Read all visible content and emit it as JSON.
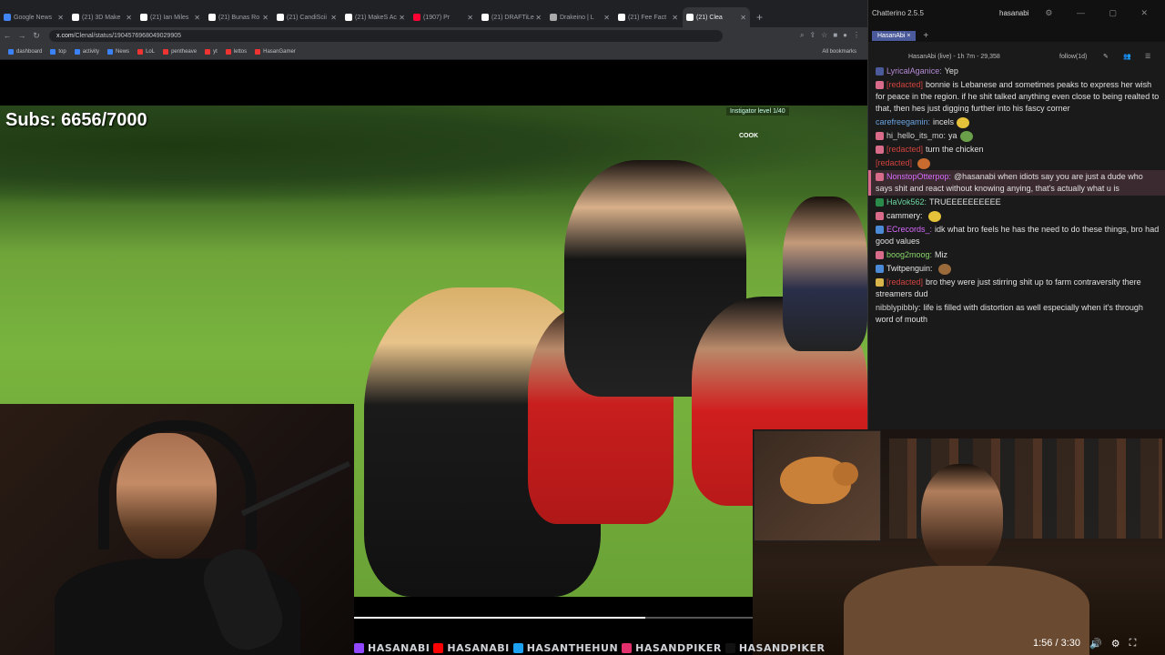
{
  "browser": {
    "tabs": [
      {
        "label": "Google News",
        "color": "#4285f4"
      },
      {
        "label": "(21) 3D Make",
        "color": "#ffffff"
      },
      {
        "label": "(21) Ian Miles",
        "color": "#ffffff"
      },
      {
        "label": "(21) Bunas Ro",
        "color": "#ffffff"
      },
      {
        "label": "(21) CandiScii",
        "color": "#ffffff"
      },
      {
        "label": "(21) MakeS Ac",
        "color": "#ffffff"
      },
      {
        "label": "(1907) Pr",
        "color": "#ff0033"
      },
      {
        "label": "(21) DRAFTiLe",
        "color": "#ffffff"
      },
      {
        "label": "Drakeino | L",
        "color": "#aaaaaa"
      },
      {
        "label": "(21) Fee Fact",
        "color": "#ffffff"
      },
      {
        "label": "(21) Clea",
        "color": "#ffffff"
      }
    ],
    "new_tab": "+",
    "url_host": "x.com",
    "url_path": "/Clenal/status/1904576968049029905",
    "bookmarks": [
      {
        "label": "dashboard",
        "color": "#3b82f6"
      },
      {
        "label": "top",
        "color": "#3b82f6"
      },
      {
        "label": "activity",
        "color": "#3b82f6"
      },
      {
        "label": "News",
        "color": "#3b82f6"
      },
      {
        "label": "LoL",
        "color": "#e33"
      },
      {
        "label": "pentheave",
        "color": "#e33"
      },
      {
        "label": "yt",
        "color": "#e33"
      },
      {
        "label": "lettos",
        "color": "#e33"
      },
      {
        "label": "HasanGamer",
        "color": "#e33"
      }
    ],
    "all_bookmarks": "All bookmarks"
  },
  "video": {
    "subs_overlay": "Subs: 6656/7000",
    "instigator_text": "Instigator level 1/40",
    "cook_text": "COOK",
    "progress_percent": 73,
    "time_display": "1:56 / 3:30"
  },
  "brand_strip": [
    {
      "label": "HASANABI",
      "color": "#9146ff"
    },
    {
      "label": "HASANABI",
      "color": "#ff0000"
    },
    {
      "label": "HASANTHEHUN",
      "color": "#1da1f2"
    },
    {
      "label": "HASANDPIKER",
      "color": "#e1306c"
    },
    {
      "label": "HASANDPIKER",
      "color": "#111111"
    }
  ],
  "chatterino": {
    "title": "Chatterino 2.5.5",
    "user": "hasanabi",
    "tab_label": "HasanAbi",
    "tab_close": "×",
    "tab_add": "+",
    "header": "HasanAbi (live) - 1h 7m - 29,358",
    "follow": "follow(1d)",
    "messages": [
      {
        "user": "LyricalAganice:",
        "text": "Yep",
        "color": "#b58ad6",
        "highlight": false,
        "badge": "#4b5a9a"
      },
      {
        "user": "[redacted]",
        "text": "bonnie is Lebanese and sometimes peaks to express her wish for peace in the region. if he shit talked anything even close to being realted to that, then hes just digging further into his fascy corner",
        "color": "#d0433f",
        "highlight": false,
        "badge": "#d86b8a"
      },
      {
        "user": "carefreegamin:",
        "text": "incels",
        "color": "#69a3e0",
        "highlight": false,
        "badge": "",
        "emote": "#e6c23a"
      },
      {
        "user": "hi_hello_its_mo:",
        "text": "ya",
        "color": "#d0d0d0",
        "highlight": false,
        "badge": "#d86b8a",
        "emote": "#6aa04a"
      },
      {
        "user": "[redacted]",
        "text": "turn the chicken",
        "color": "#d0433f",
        "highlight": false,
        "badge": "#d86b8a"
      },
      {
        "user": "[redacted]",
        "text": "",
        "color": "#d0433f",
        "highlight": false,
        "badge": "",
        "emote": "#c96b2e"
      },
      {
        "user": "NonstopOtterpop:",
        "text": "@hasanabi when idiots say you are just a dude who says shit and react without knowing anying, that's actually what u is",
        "color": "#d86bff",
        "highlight": true,
        "badge": "#d86b8a"
      },
      {
        "user": "HaVok562:",
        "text": "TRUEEEEEEEEEE",
        "color": "#6ad6a0",
        "highlight": false,
        "badge": "#2a8a4a"
      },
      {
        "user": "cammery:",
        "text": "",
        "color": "#e6e6e6",
        "highlight": false,
        "badge": "#d86b8a",
        "emote": "#e6c23a"
      },
      {
        "user": "ECrecords_:",
        "text": "idk what bro feels he has the need to do these things, bro had good values",
        "color": "#d86bff",
        "highlight": false,
        "badge": "#4b8ad6"
      },
      {
        "user": "boog2moog:",
        "text": "Miz",
        "color": "#8ad66b",
        "highlight": false,
        "badge": "#d86b8a"
      },
      {
        "user": "Twitpenguin:",
        "text": "",
        "color": "#e6e6e6",
        "highlight": false,
        "badge": "#4b8ad6",
        "emote": "#9a6a3a"
      },
      {
        "user": "[redacted]",
        "text": "bro they were just stirring shit up to farm contraversity there streamers dud",
        "color": "#d0433f",
        "highlight": false,
        "badge": "#d8b44a"
      },
      {
        "user": "nibblypibbly:",
        "text": "life is filled with distortion as well especially when it's through word of mouth",
        "color": "#d0d0d0",
        "highlight": false,
        "badge": ""
      }
    ]
  }
}
